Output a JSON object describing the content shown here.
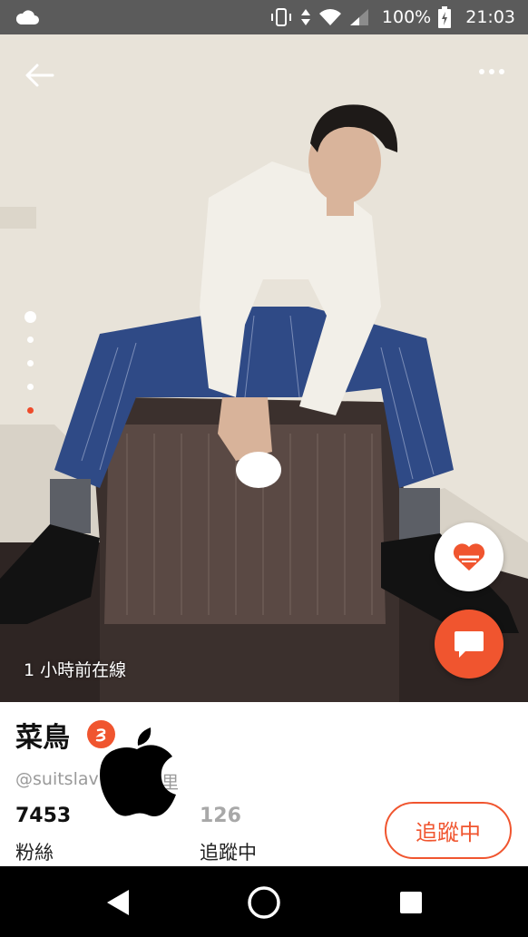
{
  "status_bar": {
    "battery_percent": "100%",
    "time": "21:03",
    "icons": [
      "cloud-icon",
      "vibrate-icon",
      "data-arrows-icon",
      "wifi-icon",
      "signal-icon",
      "battery-charging-icon"
    ]
  },
  "photo": {
    "online_status": "1 小時前在線",
    "carousel": {
      "count": 5,
      "active_index": 4
    }
  },
  "actions": {
    "back": "back-arrow-icon",
    "more": "more-dots-icon",
    "like": "heart-icon",
    "chat": "chat-bubble-icon"
  },
  "profile": {
    "name": "菜鳥",
    "handle": "@suitslav",
    "handle_tail": "里",
    "followers_count": "7453",
    "followers_label": "粉絲",
    "following_count": "126",
    "following_label": "追蹤中",
    "follow_button_label": "追蹤中"
  },
  "nav": [
    "back-triangle-icon",
    "home-circle-icon",
    "recents-square-icon"
  ],
  "colors": {
    "accent": "#f0552f",
    "status_bar": "#5b5b5b",
    "nav_bar": "#000000",
    "active_dot": "#ee4b2b"
  }
}
